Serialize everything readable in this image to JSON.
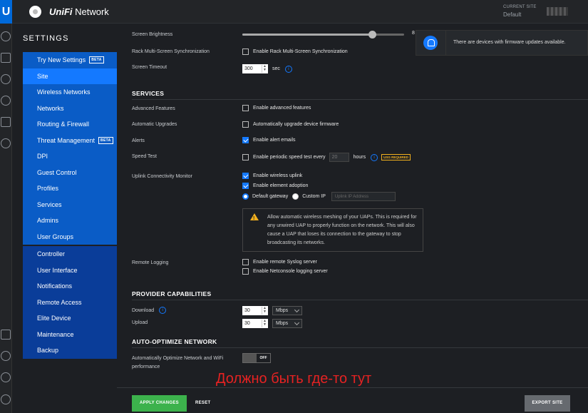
{
  "app": {
    "logo": "U",
    "brand": "UniFi",
    "name": " Network"
  },
  "site": {
    "label": "CURRENT SITE",
    "value": "Default"
  },
  "settings_title": "SETTINGS",
  "nav": {
    "group1": [
      {
        "label": "Try New Settings",
        "badge": "BETA"
      },
      {
        "label": "Site"
      },
      {
        "label": "Wireless Networks"
      },
      {
        "label": "Networks"
      },
      {
        "label": "Routing & Firewall"
      },
      {
        "label": "Threat Management",
        "badge": "BETA"
      },
      {
        "label": "DPI"
      },
      {
        "label": "Guest Control"
      },
      {
        "label": "Profiles"
      },
      {
        "label": "Services"
      },
      {
        "label": "Admins"
      },
      {
        "label": "User Groups"
      }
    ],
    "group2": [
      {
        "label": "Controller"
      },
      {
        "label": "User Interface"
      },
      {
        "label": "Notifications"
      },
      {
        "label": "Remote Access"
      },
      {
        "label": "Elite Device"
      },
      {
        "label": "Maintenance"
      },
      {
        "label": "Backup"
      }
    ]
  },
  "brightness": {
    "label": "Screen Brightness",
    "value": 8,
    "max": 10
  },
  "rack": {
    "label": "Rack Multi-Screen Synchronization",
    "option": "Enable Rack Multi-Screen Synchronization"
  },
  "timeout": {
    "label": "Screen Timeout",
    "value": "300",
    "unit": "sec"
  },
  "services": {
    "title": "SERVICES",
    "advanced": {
      "label": "Advanced Features",
      "option": "Enable advanced features"
    },
    "upgrades": {
      "label": "Automatic Upgrades",
      "option": "Automatically upgrade device firmware"
    },
    "alerts": {
      "label": "Alerts",
      "option": "Enable alert emails"
    },
    "speed": {
      "label": "Speed Test",
      "option": "Enable periodic speed test every",
      "value": "20",
      "unit": "hours",
      "badge": "USG REQUIRED"
    },
    "uplink": {
      "label": "Uplink Connectivity Monitor",
      "opt1": "Enable wireless uplink",
      "opt2": "Enable element adoption",
      "radio1": "Default gateway",
      "radio2": "Custom IP",
      "placeholder": "Uplink IP Address"
    },
    "warning": "Allow automatic wireless meshing of your UAPs. This is required for any unwired UAP to properly function on the network. This will also cause a UAP that loses its connection to the gateway to stop broadcasting its networks.",
    "logging": {
      "label": "Remote Logging",
      "opt1": "Enable remote Syslog server",
      "opt2": "Enable Netconsole logging server"
    }
  },
  "provider": {
    "title": "PROVIDER CAPABILITIES",
    "download": {
      "label": "Download",
      "value": "30",
      "unit": "Mbps"
    },
    "upload": {
      "label": "Upload",
      "value": "30",
      "unit": "Mbps"
    }
  },
  "auto": {
    "title": "AUTO-OPTIMIZE NETWORK",
    "label": "Automatically Optimize Network and WiFi performance",
    "toggle": "OFF"
  },
  "notification": "There are devices with firmware updates available.",
  "annotation": "Должно быть где-то тут",
  "buttons": {
    "apply": "APPLY CHANGES",
    "reset": "RESET",
    "export": "EXPORT SITE"
  }
}
